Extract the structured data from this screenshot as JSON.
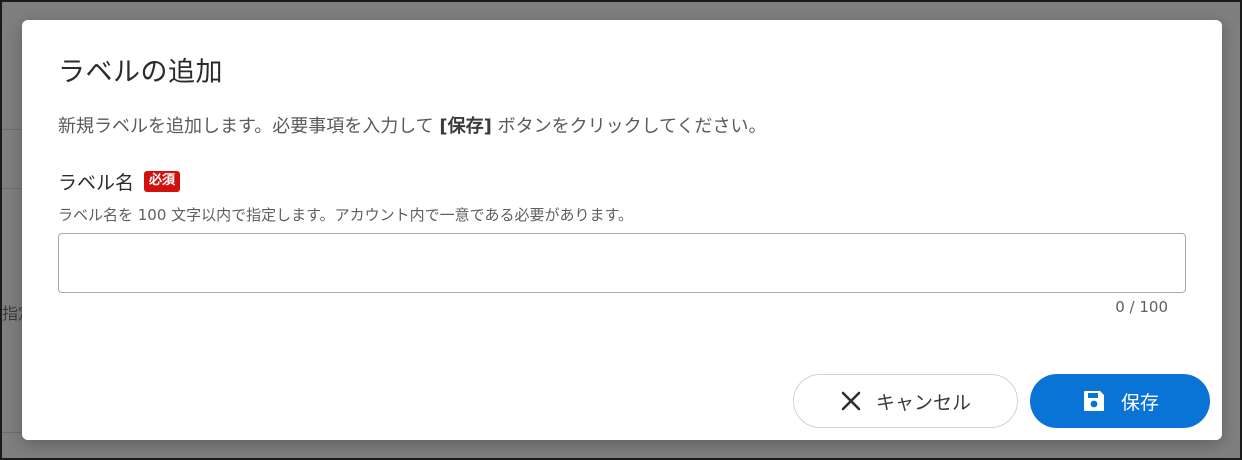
{
  "background": {
    "fragment_text": "指定"
  },
  "dialog": {
    "title": "ラベルの追加",
    "description_prefix": "新規ラベルを追加します。必要事項を入力して ",
    "description_bold": "[保存]",
    "description_suffix": " ボタンをクリックしてください。",
    "field": {
      "label": "ラベル名",
      "required_badge": "必須",
      "hint": "ラベル名を 100 文字以内で指定します。アカウント内で一意である必要があります。",
      "value": "",
      "placeholder": "",
      "counter": "0 / 100"
    },
    "buttons": {
      "cancel_label": "キャンセル",
      "cancel_icon": "close-icon",
      "save_label": "保存",
      "save_icon": "save-icon"
    }
  },
  "colors": {
    "primary": "#0a74d6",
    "required": "#d11010",
    "overlay": "#7f7f7f"
  }
}
